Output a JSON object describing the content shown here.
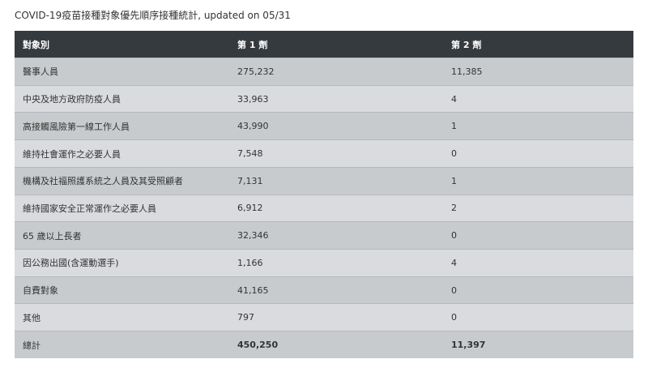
{
  "page": {
    "title": "COVID-19疫苗接種對象優先順序接種統計, updated on 05/31"
  },
  "chart_data": {
    "type": "table",
    "columns": [
      "對象別",
      "第 1 劑",
      "第 2 劑"
    ],
    "rows": [
      [
        "醫事人員",
        "275,232",
        "11,385"
      ],
      [
        "中央及地方政府防疫人員",
        "33,963",
        "4"
      ],
      [
        "高接觸風險第一線工作人員",
        "43,990",
        "1"
      ],
      [
        "維持社會運作之必要人員",
        "7,548",
        "0"
      ],
      [
        "機構及社福照護系統之人員及其受照顧者",
        "7,131",
        "1"
      ],
      [
        "維持國家安全正常運作之必要人員",
        "6,912",
        "2"
      ],
      [
        "65 歲以上長者",
        "32,346",
        "0"
      ],
      [
        "因公務出國(含運動選手)",
        "1,166",
        "4"
      ],
      [
        "自費對象",
        "41,165",
        "0"
      ],
      [
        "其他",
        "797",
        "0"
      ],
      [
        "總計",
        "450,250",
        "11,397"
      ]
    ]
  },
  "colors": {
    "header_bg": "#353a3f",
    "row_odd": "#c8cbce",
    "row_even": "#d9dbde"
  }
}
